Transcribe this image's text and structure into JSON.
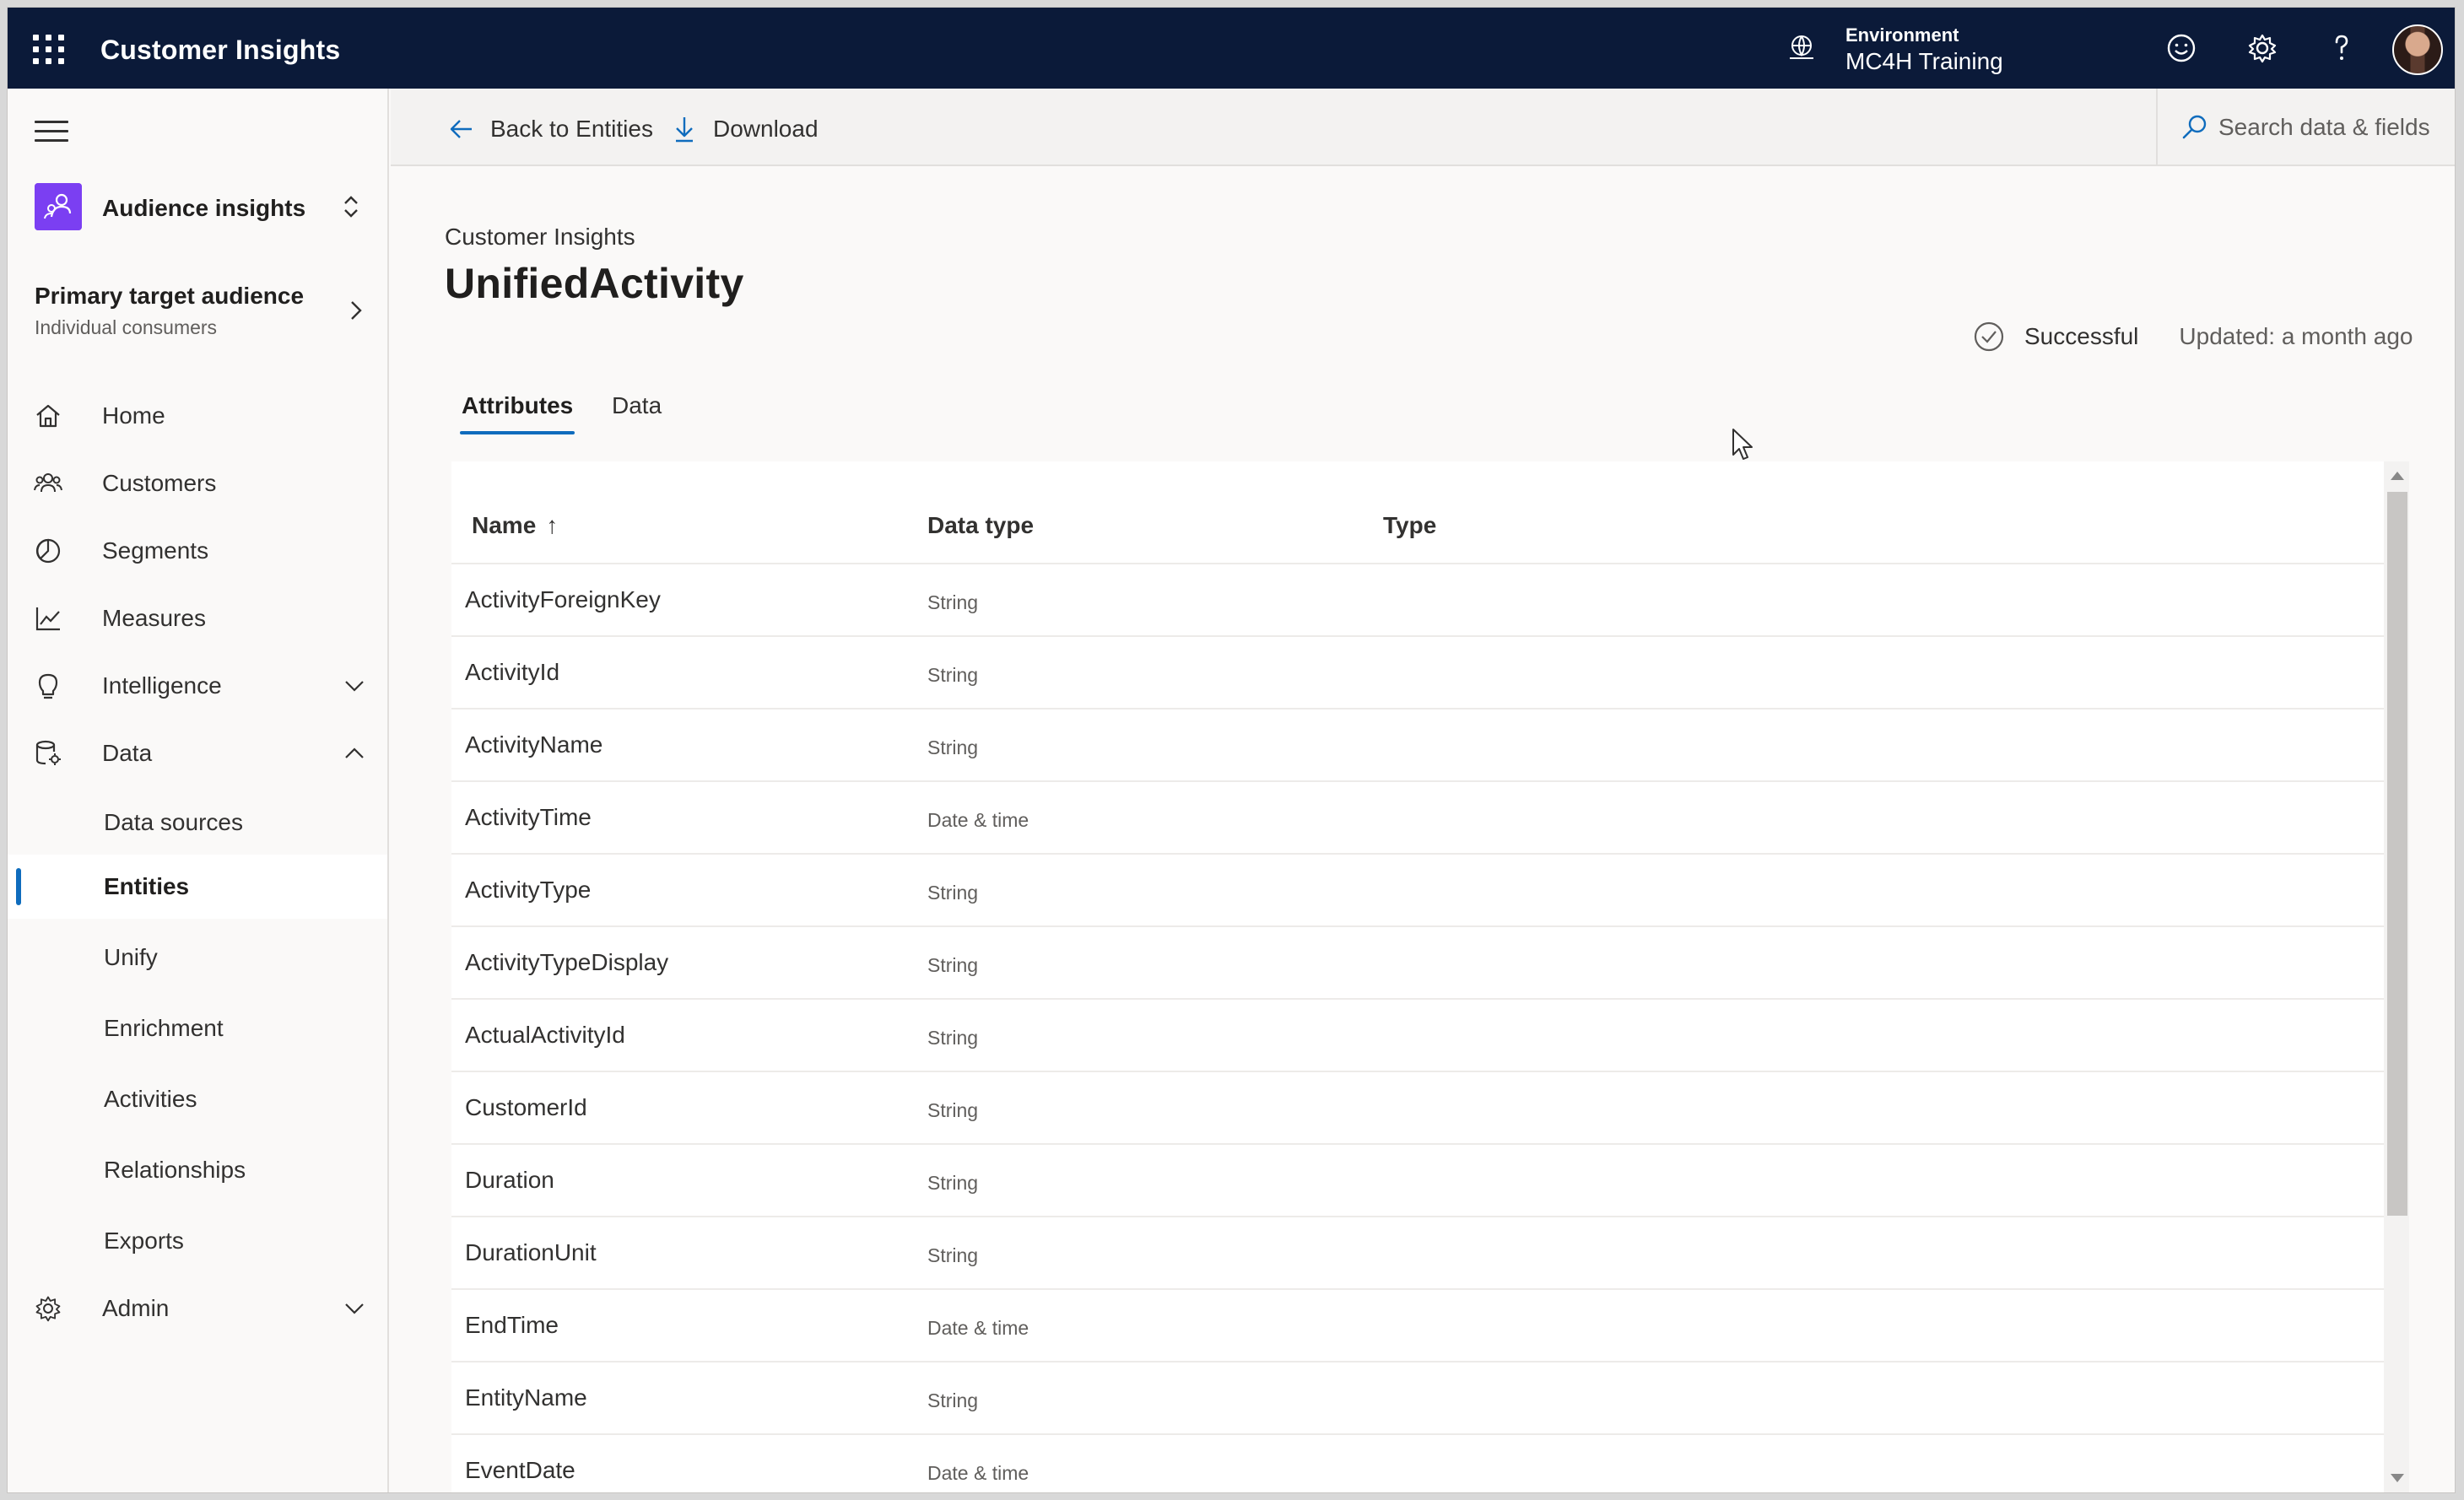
{
  "topbar": {
    "app_title": "Customer Insights",
    "environment_label": "Environment",
    "environment_value": "MC4H Training",
    "icons": [
      "waffle-icon",
      "environment-icon",
      "feedback-smiley-icon",
      "settings-gear-icon",
      "help-icon",
      "avatar"
    ]
  },
  "sidebar": {
    "audience_switcher": {
      "label": "Audience insights"
    },
    "target_audience": {
      "title": "Primary target audience",
      "subtitle": "Individual consumers"
    },
    "nav": [
      {
        "label": "Home",
        "icon": "home-icon"
      },
      {
        "label": "Customers",
        "icon": "customers-icon"
      },
      {
        "label": "Segments",
        "icon": "segments-icon"
      },
      {
        "label": "Measures",
        "icon": "measures-icon"
      },
      {
        "label": "Intelligence",
        "icon": "lightbulb-icon",
        "expanded": false
      },
      {
        "label": "Data",
        "icon": "data-icon",
        "expanded": true
      },
      {
        "label": "Admin",
        "icon": "gear-icon",
        "expanded": false
      }
    ],
    "data_subitems": [
      {
        "label": "Data sources",
        "active": false
      },
      {
        "label": "Entities",
        "active": true
      },
      {
        "label": "Unify",
        "active": false
      },
      {
        "label": "Enrichment",
        "active": false
      },
      {
        "label": "Activities",
        "active": false
      },
      {
        "label": "Relationships",
        "active": false
      },
      {
        "label": "Exports",
        "active": false
      }
    ]
  },
  "commandbar": {
    "back_label": "Back to Entities",
    "download_label": "Download",
    "search_placeholder": "Search data & fields"
  },
  "main": {
    "breadcrumb": "Customer Insights",
    "title": "UnifiedActivity",
    "status": "Successful",
    "updated": "Updated: a month ago",
    "tabs": [
      {
        "label": "Attributes",
        "active": true
      },
      {
        "label": "Data",
        "active": false
      }
    ],
    "table": {
      "columns": [
        "Name",
        "Data type",
        "Type"
      ],
      "sort_indicator": "↑",
      "rows": [
        {
          "name": "ActivityForeignKey",
          "data_type": "String",
          "type": ""
        },
        {
          "name": "ActivityId",
          "data_type": "String",
          "type": ""
        },
        {
          "name": "ActivityName",
          "data_type": "String",
          "type": ""
        },
        {
          "name": "ActivityTime",
          "data_type": "Date & time",
          "type": ""
        },
        {
          "name": "ActivityType",
          "data_type": "String",
          "type": ""
        },
        {
          "name": "ActivityTypeDisplay",
          "data_type": "String",
          "type": ""
        },
        {
          "name": "ActualActivityId",
          "data_type": "String",
          "type": ""
        },
        {
          "name": "CustomerId",
          "data_type": "String",
          "type": ""
        },
        {
          "name": "Duration",
          "data_type": "String",
          "type": ""
        },
        {
          "name": "DurationUnit",
          "data_type": "String",
          "type": ""
        },
        {
          "name": "EndTime",
          "data_type": "Date & time",
          "type": ""
        },
        {
          "name": "EntityName",
          "data_type": "String",
          "type": ""
        },
        {
          "name": "EventDate",
          "data_type": "Date & time",
          "type": ""
        }
      ]
    }
  },
  "colors": {
    "topbar_bg": "#0b1a39",
    "accent": "#0f6cbd",
    "audience_icon_bg": "#7b3ff2",
    "page_bg": "#faf9f8"
  }
}
